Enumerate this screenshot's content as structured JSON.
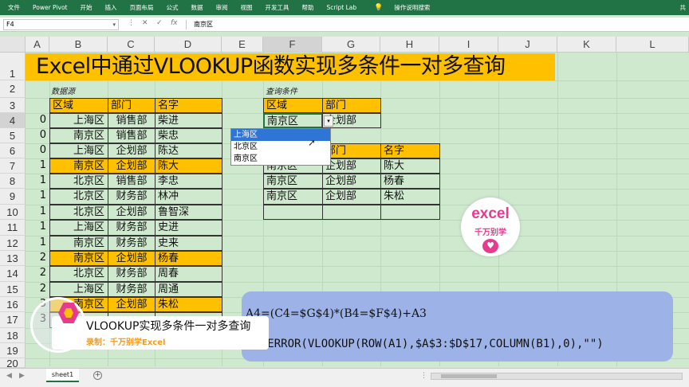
{
  "ribbon": {
    "tabs": [
      "文件",
      "Power Pivot",
      "开始",
      "插入",
      "页面布局",
      "公式",
      "数据",
      "审阅",
      "视图",
      "开发工具",
      "帮助",
      "Script Lab"
    ],
    "search": "操作说明搜索",
    "share": "共"
  },
  "formula_bar": {
    "name_box": "F4",
    "cancel": "✕",
    "enter": "✓",
    "fx": "fx",
    "content": "南京区"
  },
  "columns": [
    "A",
    "B",
    "C",
    "D",
    "E",
    "F",
    "G",
    "H",
    "I",
    "J",
    "K",
    "L"
  ],
  "rows": [
    "1",
    "2",
    "3",
    "4",
    "5",
    "6",
    "7",
    "8",
    "9",
    "10",
    "11",
    "12",
    "13",
    "14",
    "15",
    "16",
    "17",
    "18",
    "19",
    "20"
  ],
  "title": "Excel中通过VLOOKUP函数实现多条件一对多查询",
  "source_label": "数据源",
  "query_label": "查询条件",
  "source_table": {
    "headers": [
      "区域",
      "部门",
      "名字"
    ],
    "rows": [
      {
        "helper": "0",
        "region": "上海区",
        "dept": "销售部",
        "name": "柴进"
      },
      {
        "helper": "0",
        "region": "南京区",
        "dept": "销售部",
        "name": "柴忠"
      },
      {
        "helper": "0",
        "region": "上海区",
        "dept": "企划部",
        "name": "陈达"
      },
      {
        "helper": "1",
        "region": "南京区",
        "dept": "企划部",
        "name": "陈大"
      },
      {
        "helper": "1",
        "region": "北京区",
        "dept": "销售部",
        "name": "李忠"
      },
      {
        "helper": "1",
        "region": "北京区",
        "dept": "财务部",
        "name": "林冲"
      },
      {
        "helper": "1",
        "region": "北京区",
        "dept": "企划部",
        "name": "鲁智深"
      },
      {
        "helper": "1",
        "region": "上海区",
        "dept": "财务部",
        "name": "史进"
      },
      {
        "helper": "1",
        "region": "南京区",
        "dept": "财务部",
        "name": "史来"
      },
      {
        "helper": "2",
        "region": "南京区",
        "dept": "企划部",
        "name": "杨春"
      },
      {
        "helper": "2",
        "region": "北京区",
        "dept": "财务部",
        "name": "周春"
      },
      {
        "helper": "2",
        "region": "上海区",
        "dept": "财务部",
        "name": "周通"
      },
      {
        "helper": "3",
        "region": "南京区",
        "dept": "企划部",
        "name": "朱松"
      },
      {
        "helper": "3",
        "region": "",
        "dept": "",
        "name": ""
      }
    ]
  },
  "query_table": {
    "headers": [
      "区域",
      "部门"
    ],
    "values": [
      "南京区",
      "企划部"
    ]
  },
  "dropdown": {
    "options": [
      "上海区",
      "北京区",
      "南京区"
    ],
    "selected": "上海区"
  },
  "result_table": {
    "headers": [
      "部门",
      "名字"
    ],
    "rows": [
      {
        "region": "南京区",
        "dept": "企划部",
        "name": "陈大"
      },
      {
        "region": "南京区",
        "dept": "企划部",
        "name": "杨春"
      },
      {
        "region": "南京区",
        "dept": "企划部",
        "name": "朱松"
      },
      {
        "region": "",
        "dept": "",
        "name": ""
      }
    ]
  },
  "logo": {
    "line1": "excel",
    "line2": "千万别学"
  },
  "formulas": {
    "line1": "A4=(C4=$G$4)*(B4=$F$4)+A3",
    "line2": "=IFERROR(VLOOKUP(ROW(A1),$A$3:$D$17,COLUMN(B1),0),\"\")"
  },
  "caption": {
    "title": "VLOOKUP实现多条件一对多查询",
    "subtitle": "录制：千万别学Excel"
  },
  "sheet_tabs": [
    "sheet1"
  ],
  "colors": {
    "accent": "#217346",
    "highlight": "#ffc000",
    "sheet_bg": "#cfe9cf",
    "note_bg": "#9db2e6",
    "brand": "#e53c8f"
  }
}
